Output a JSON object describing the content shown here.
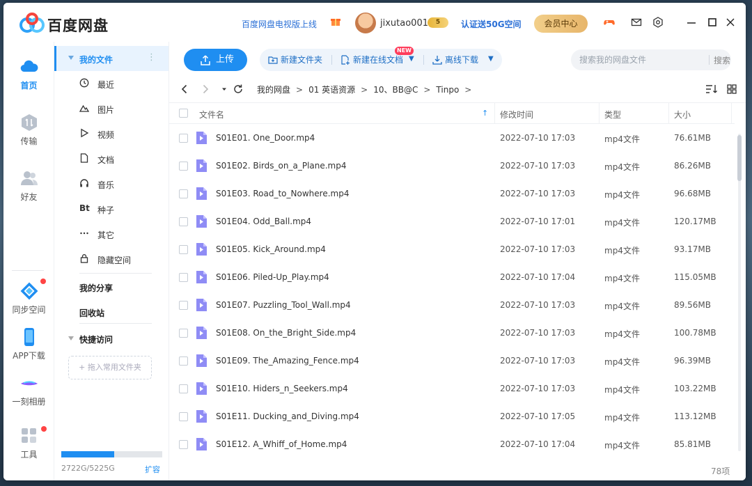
{
  "app": {
    "title": "百度网盘",
    "promo": "百度网盘电视版上线",
    "username": "jixutao001",
    "vip_level": "5",
    "certify": "认证送50G空间",
    "member_center": "会员中心",
    "brand_color": "#1f8ef1"
  },
  "leftnav": {
    "items": [
      {
        "label": "首页",
        "icon": "cloud-icon",
        "active": true
      },
      {
        "label": "传输",
        "icon": "transfer-icon"
      },
      {
        "label": "好友",
        "icon": "friends-icon"
      },
      {
        "label": "同步空间",
        "icon": "sync-space-icon"
      },
      {
        "label": "APP下载",
        "icon": "phone-icon"
      },
      {
        "label": "一刻相册",
        "icon": "album-icon"
      },
      {
        "label": "工具",
        "icon": "tools-icon"
      }
    ]
  },
  "sidebar": {
    "my_files": "我的文件",
    "categories": [
      {
        "label": "最近",
        "icon": "clock-icon"
      },
      {
        "label": "图片",
        "icon": "image-icon"
      },
      {
        "label": "视频",
        "icon": "play-icon"
      },
      {
        "label": "文档",
        "icon": "document-icon"
      },
      {
        "label": "音乐",
        "icon": "headphones-icon"
      },
      {
        "label": "种子",
        "icon": "bt-icon",
        "glyph": "Bt"
      },
      {
        "label": "其它",
        "icon": "more-icon"
      },
      {
        "label": "隐藏空间",
        "icon": "lock-icon"
      }
    ],
    "my_share": "我的分享",
    "recycle_bin": "回收站",
    "quick_access": "快捷访问",
    "drop_hint": "+ 拖入常用文件夹",
    "quota_text": "2722G/5225G",
    "quota_used": 2722,
    "quota_total": 5225,
    "expand": "扩容"
  },
  "toolbar": {
    "upload": "上传",
    "new_folder": "新建文件夹",
    "new_online_doc": "新建在线文档",
    "new_badge": "NEW",
    "offline_download": "离线下载",
    "search_placeholder": "搜索我的网盘文件",
    "search_button": "搜索"
  },
  "breadcrumb": [
    "我的网盘",
    "01 英语资源",
    "10、BB@C",
    "Tinpo"
  ],
  "table": {
    "headers": {
      "name": "文件名",
      "mtime": "修改时间",
      "type": "类型",
      "size": "大小"
    },
    "rows": [
      {
        "name": "S01E01. One_Door.mp4",
        "mtime": "2022-07-10 17:03",
        "type": "mp4文件",
        "size": "76.61MB"
      },
      {
        "name": "S01E02. Birds_on_a_Plane.mp4",
        "mtime": "2022-07-10 17:03",
        "type": "mp4文件",
        "size": "86.26MB"
      },
      {
        "name": "S01E03. Road_to_Nowhere.mp4",
        "mtime": "2022-07-10 17:03",
        "type": "mp4文件",
        "size": "96.68MB"
      },
      {
        "name": "S01E04. Odd_Ball.mp4",
        "mtime": "2022-07-10 17:01",
        "type": "mp4文件",
        "size": "120.17MB"
      },
      {
        "name": "S01E05. Kick_Around.mp4",
        "mtime": "2022-07-10 17:03",
        "type": "mp4文件",
        "size": "93.17MB"
      },
      {
        "name": "S01E06. Piled-Up_Play.mp4",
        "mtime": "2022-07-10 17:04",
        "type": "mp4文件",
        "size": "115.05MB"
      },
      {
        "name": "S01E07. Puzzling_Tool_Wall.mp4",
        "mtime": "2022-07-10 17:03",
        "type": "mp4文件",
        "size": "89.56MB"
      },
      {
        "name": "S01E08. On_the_Bright_Side.mp4",
        "mtime": "2022-07-10 17:03",
        "type": "mp4文件",
        "size": "100.78MB"
      },
      {
        "name": "S01E09. The_Amazing_Fence.mp4",
        "mtime": "2022-07-10 17:03",
        "type": "mp4文件",
        "size": "96.39MB"
      },
      {
        "name": "S01E10. Hiders_n_Seekers.mp4",
        "mtime": "2022-07-10 17:03",
        "type": "mp4文件",
        "size": "103.22MB"
      },
      {
        "name": "S01E11. Ducking_and_Diving.mp4",
        "mtime": "2022-07-10 17:05",
        "type": "mp4文件",
        "size": "113.12MB"
      },
      {
        "name": "S01E12. A_Whiff_of_Home.mp4",
        "mtime": "2022-07-10 17:04",
        "type": "mp4文件",
        "size": "85.81MB"
      }
    ]
  },
  "status": {
    "item_count": "78项"
  }
}
